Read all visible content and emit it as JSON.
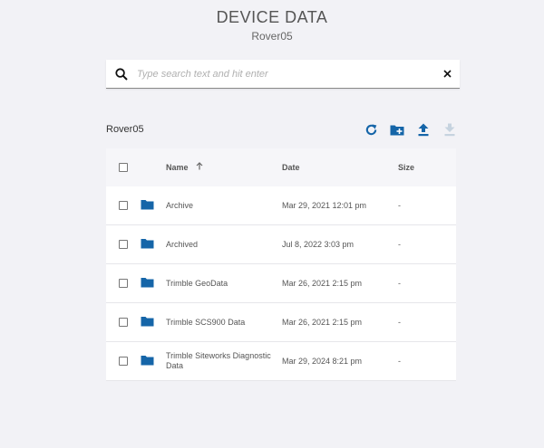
{
  "header": {
    "title": "DEVICE DATA",
    "subtitle": "Rover05"
  },
  "search": {
    "placeholder": "Type search text and hit enter",
    "value": ""
  },
  "toolbar": {
    "folder_name": "Rover05"
  },
  "colors": {
    "accent": "#1565a8",
    "disabled": "#c6d3df"
  },
  "table": {
    "columns": {
      "name": "Name",
      "date": "Date",
      "size": "Size"
    },
    "sort": {
      "column": "Name",
      "direction": "ascending"
    },
    "rows": [
      {
        "name": "Archive",
        "date": "Mar 29, 2021 12:01 pm",
        "size": "-"
      },
      {
        "name": "Archived",
        "date": "Jul 8, 2022 3:03 pm",
        "size": "-"
      },
      {
        "name": "Trimble GeoData",
        "date": "Mar 26, 2021 2:15 pm",
        "size": "-"
      },
      {
        "name": "Trimble SCS900 Data",
        "date": "Mar 26, 2021 2:15 pm",
        "size": "-"
      },
      {
        "name": "Trimble Siteworks Diagnostic Data",
        "date": "Mar 29, 2024 8:21 pm",
        "size": "-"
      }
    ]
  }
}
